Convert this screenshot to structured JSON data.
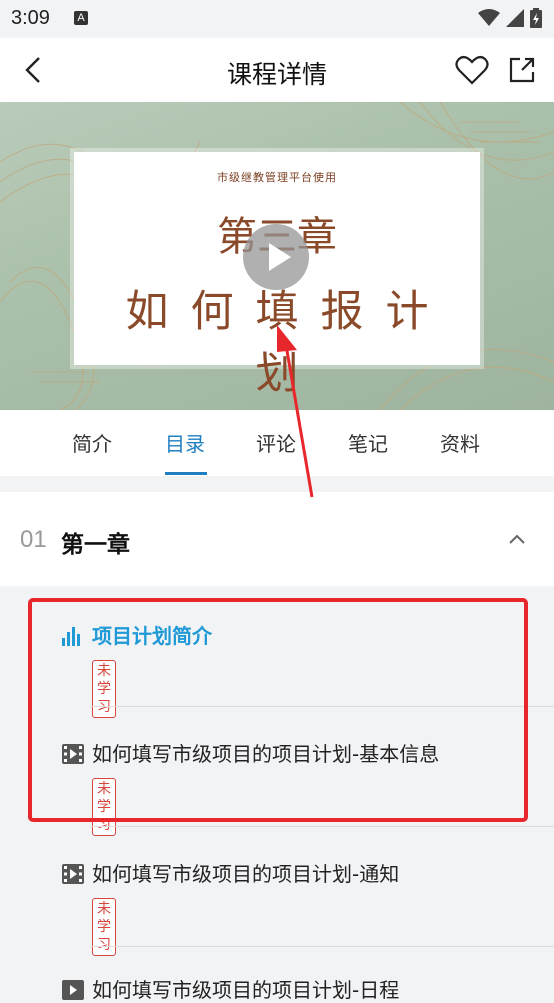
{
  "status_bar": {
    "time": "3:09",
    "notification_letter": "A"
  },
  "header": {
    "title": "课程详情"
  },
  "video": {
    "slide_subtitle": "市级继教管理平台使用",
    "slide_chapter": "第三章",
    "slide_title": "如何填报计划"
  },
  "tabs": [
    "简介",
    "目录",
    "评论",
    "笔记",
    "资料"
  ],
  "active_tab": "目录",
  "chapter": {
    "number": "01",
    "title": "第一章"
  },
  "lessons": [
    {
      "title": "项目计划简介",
      "status": "未学习",
      "icon": "audio-bars-icon"
    },
    {
      "title": "如何填写市级项目的项目计划-基本信息",
      "status": "未学习",
      "icon": "video-file-icon"
    },
    {
      "title": "如何填写市级项目的项目计划-通知",
      "status": "未学习",
      "icon": "video-file-icon"
    },
    {
      "title": "如何填写市级项目的项目计划-日程",
      "status": "",
      "icon": "video-file-icon"
    }
  ],
  "colors": {
    "accent": "#1f7fc0",
    "highlight_box": "#e8272c",
    "badge": "#d9453c"
  }
}
